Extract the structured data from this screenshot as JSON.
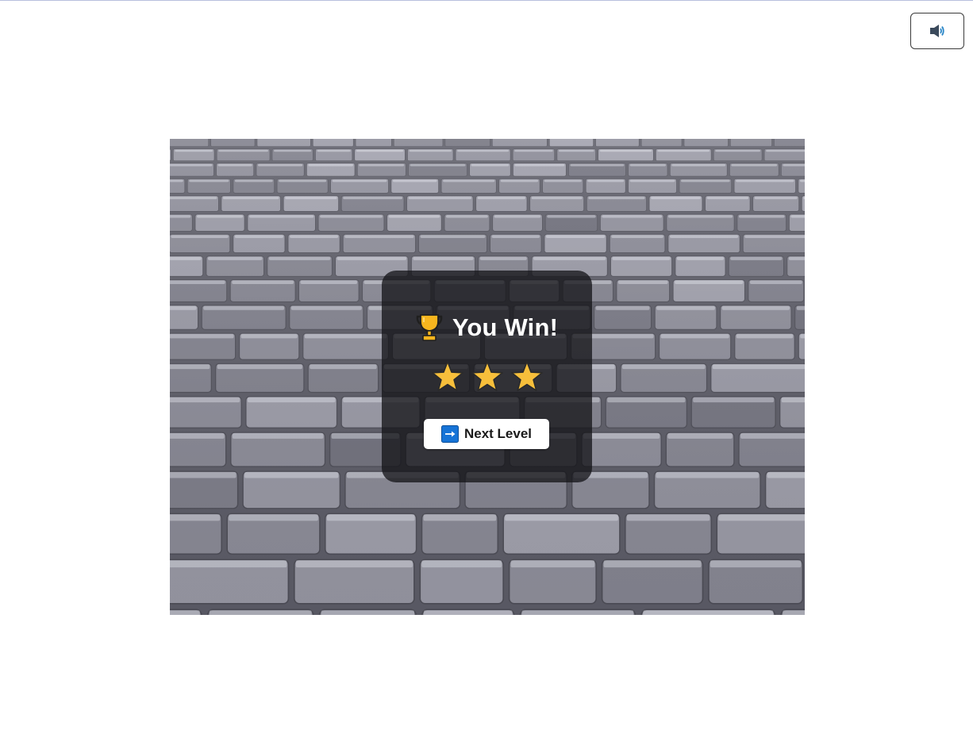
{
  "controls": {
    "sound_icon": "speaker-with-sound-icon"
  },
  "win_panel": {
    "title": "You Win!",
    "trophy_icon": "trophy-icon",
    "stars_earned": 3,
    "stars_total": 3,
    "star_color": "#f7bf3b",
    "next_button": {
      "label": "Next Level",
      "icon": "right-arrow-button-icon",
      "icon_color": "#1673d6"
    }
  },
  "background": {
    "texture": "stone-brick-floor",
    "stone_color": "#8e8e9b",
    "mortar_color": "#5d5d68"
  }
}
